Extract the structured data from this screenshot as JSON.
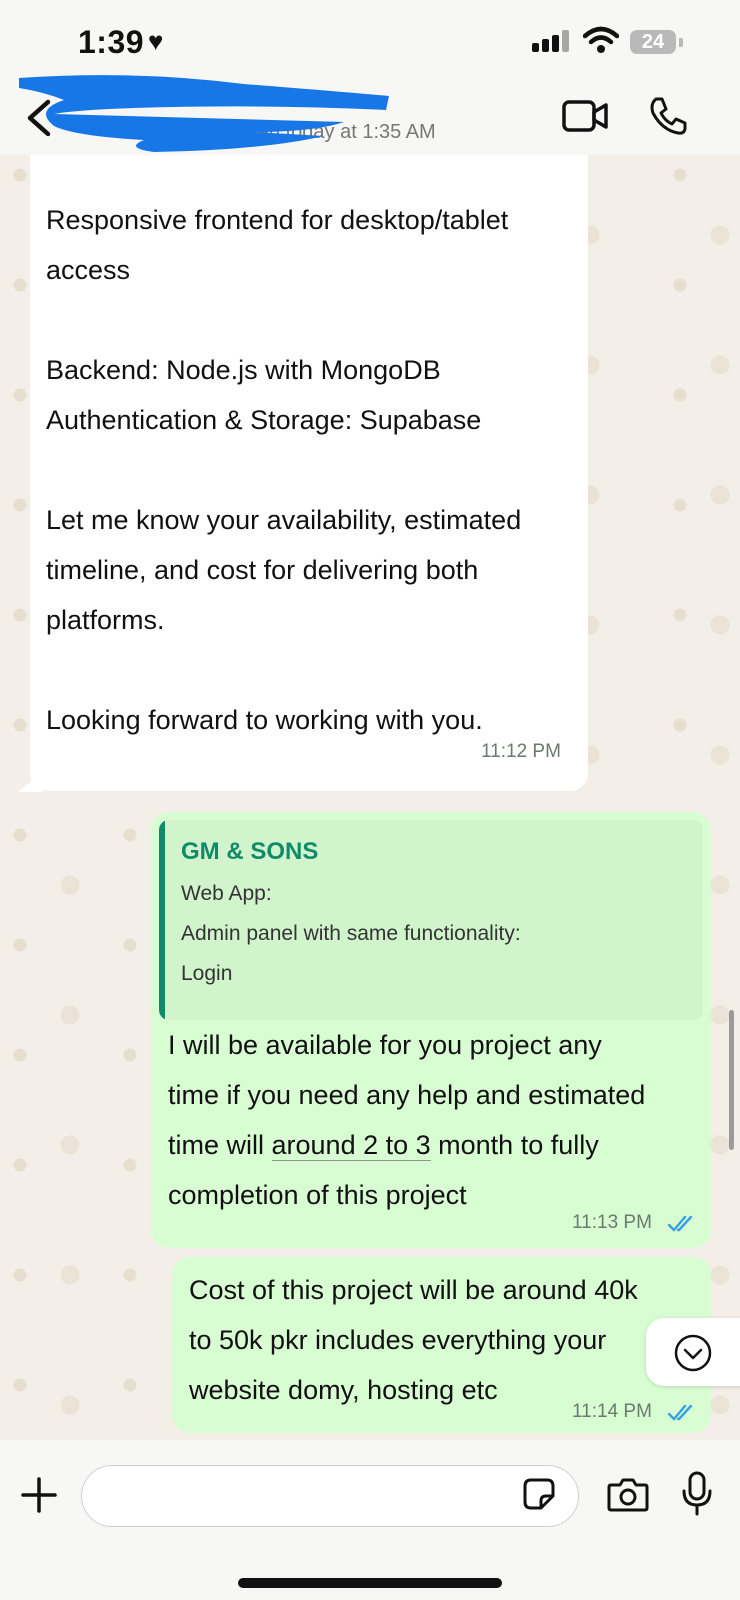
{
  "status_bar": {
    "time": "1:39",
    "battery": "24"
  },
  "header": {
    "last_seen": "last seen today at 1:35 AM"
  },
  "incoming": {
    "text": "Responsive frontend for desktop/tablet\naccess\n\nBackend: Node.js with MongoDB\nAuthentication & Storage: Supabase\n\nLet me know your availability, estimated\ntimeline, and cost for delivering both\nplatforms.\n\nLooking forward to working with you.",
    "time": "11:12 PM"
  },
  "outgoing_1": {
    "quote": {
      "author": "GM & SONS",
      "lines": [
        "Web App:",
        "Admin panel with same functionality:",
        "Login"
      ]
    },
    "lines": [
      "I will be available for you project any",
      "time if you need any help and estimated"
    ],
    "line3_pre": "time will ",
    "line3_link": "around 2 to 3",
    "line3_post": " month to fully",
    "line4": "completion of this project",
    "time": "11:13 PM"
  },
  "outgoing_2": {
    "lines": [
      "Cost of this project will be around 40k",
      "to 50k pkr includes everything your",
      "website domy, hosting etc"
    ],
    "time": "11:14 PM"
  },
  "colors": {
    "accent": "#0f8b6a",
    "outgoing_bubble": "#d9fdd3",
    "read_ticks": "#34a0e5"
  },
  "icons": [
    "heart-icon",
    "signal-icon",
    "wifi-icon",
    "back-icon",
    "video-call-icon",
    "phone-icon",
    "read-ticks-icon",
    "scroll-down-icon",
    "plus-icon",
    "sticker-icon",
    "camera-icon",
    "mic-icon"
  ]
}
